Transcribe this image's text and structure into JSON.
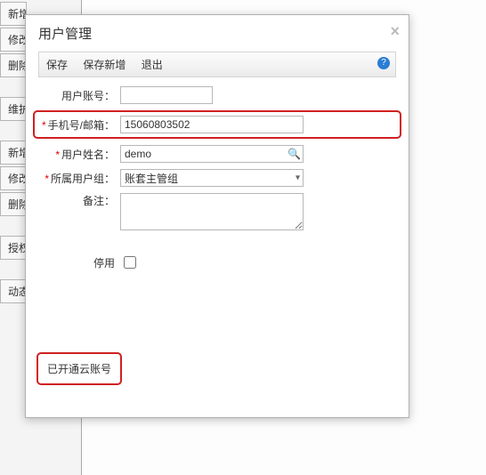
{
  "bg": {
    "buttons": [
      "新增",
      "修改",
      "删除",
      "",
      "维护",
      "",
      "新增",
      "修改",
      "删除",
      "",
      "授权",
      "",
      "动态"
    ]
  },
  "modal": {
    "title": "用户管理",
    "toolbar": {
      "save": "保存",
      "saveNew": "保存新增",
      "exit": "退出"
    },
    "fields": {
      "account": {
        "label": "用户账号：",
        "value": ""
      },
      "phone": {
        "label": "手机号/邮箱：",
        "value": "15060803502"
      },
      "name": {
        "label": "用户姓名：",
        "value": "demo"
      },
      "group": {
        "label": "所属用户组：",
        "value": "账套主管组"
      },
      "remark": {
        "label": "备注：",
        "value": ""
      },
      "disable": {
        "label": "停用"
      }
    },
    "cloudStatus": "已开通云账号"
  }
}
